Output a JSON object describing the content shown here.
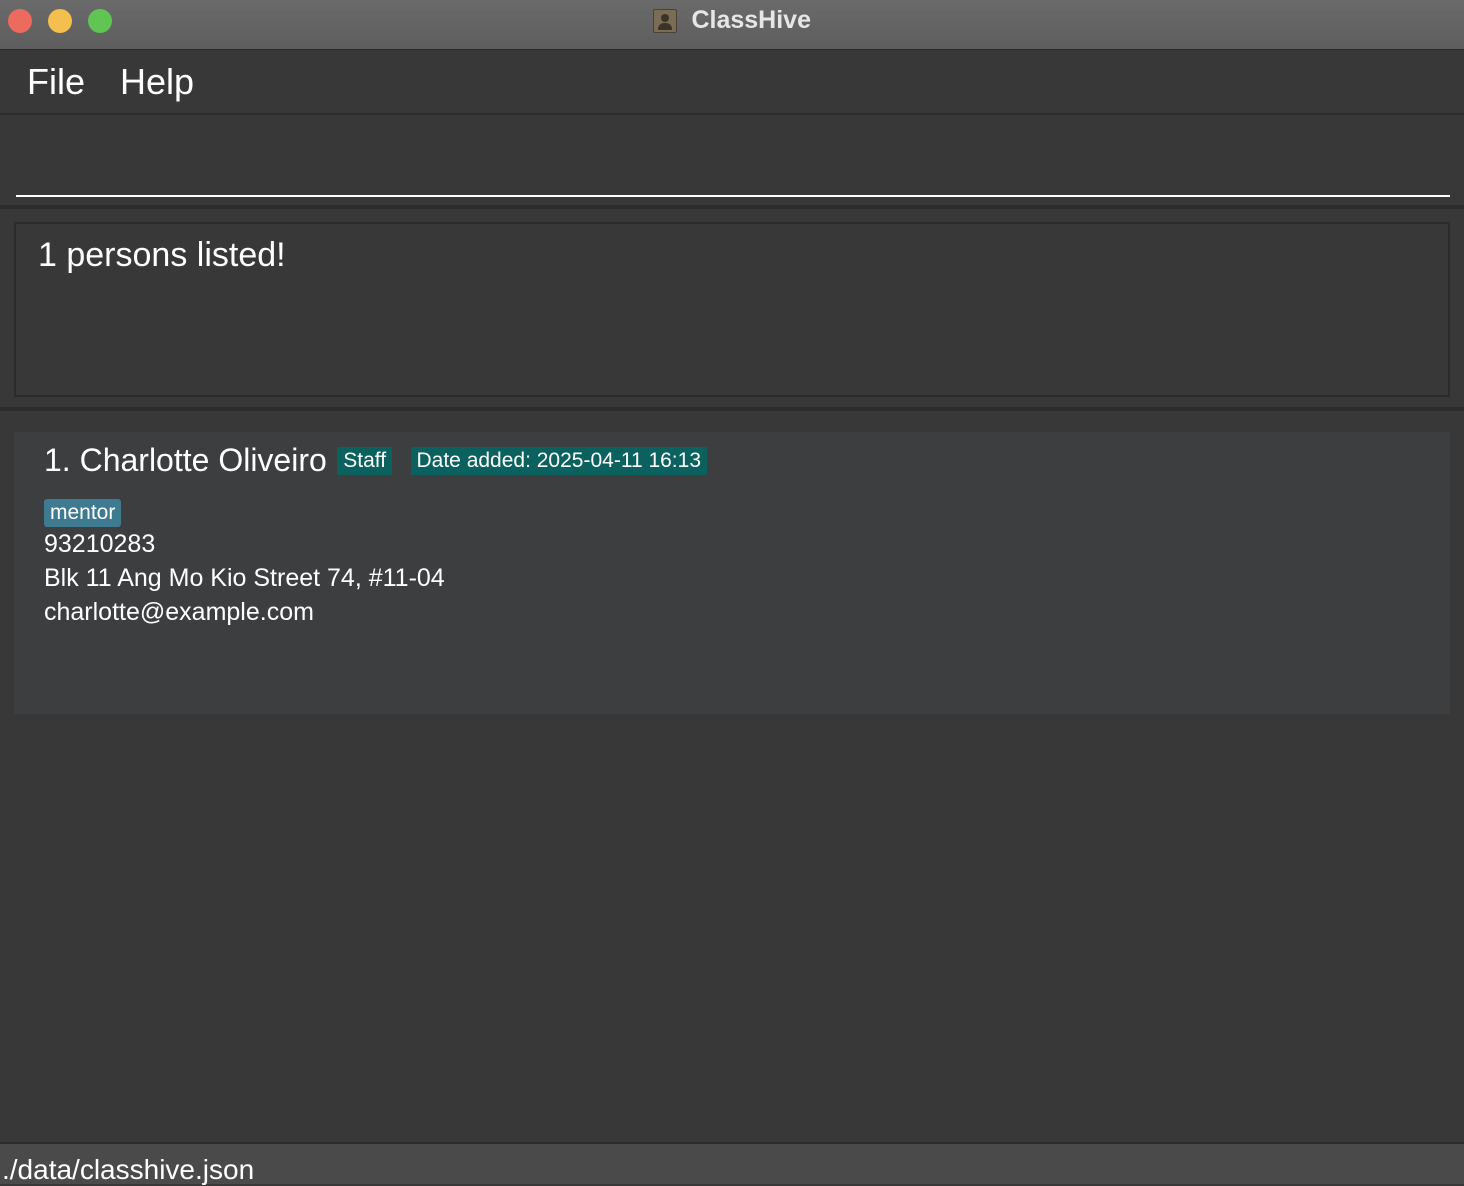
{
  "window": {
    "title": "ClassHive"
  },
  "menu": {
    "items": [
      {
        "label": "File"
      },
      {
        "label": "Help"
      }
    ]
  },
  "command": {
    "value": "",
    "placeholder": ""
  },
  "result": {
    "message": "1 persons listed!"
  },
  "persons": [
    {
      "name": "1. Charlotte Oliveiro",
      "role": "Staff",
      "date_added": "Date added: 2025-04-11 16:13",
      "tags": [
        "mentor"
      ],
      "phone": "93210283",
      "address": "Blk 11 Ang Mo Kio Street 74, #11-04",
      "email": "charlotte@example.com"
    }
  ],
  "status": {
    "file_path": "./data/classhive.json"
  },
  "colors": {
    "background": "#383838",
    "role_badge": "#0b615e",
    "tag": "#3e7b91",
    "close": "#ed6a5e",
    "minimize": "#f5bf4f",
    "zoom": "#61c554"
  }
}
